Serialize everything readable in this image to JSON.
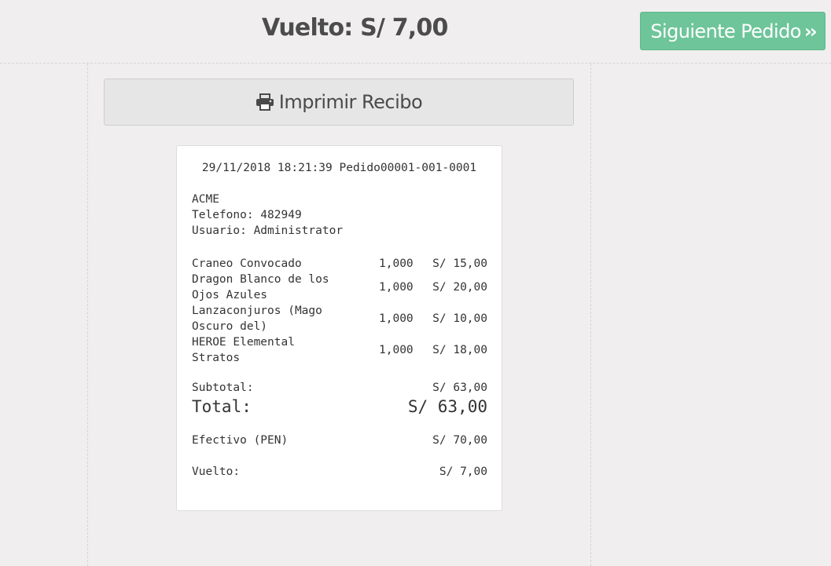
{
  "header": {
    "change_label": "Vuelto: S/ 7,00",
    "next_order_label": "Siguiente Pedido"
  },
  "print_button": {
    "label": "Imprimir Recibo"
  },
  "receipt": {
    "header_line": "29/11/2018 18:21:39 Pedido00001-001-0001",
    "company": "ACME",
    "phone": "Telefono: 482949",
    "user": "Usuario: Administrator",
    "items": [
      {
        "name_line1": "Craneo Convocado",
        "name_line2": "",
        "qty": "1,000",
        "price": "S/ 15,00"
      },
      {
        "name_line1": "Dragon Blanco de los",
        "name_line2": "Ojos Azules",
        "qty": "1,000",
        "price": "S/ 20,00"
      },
      {
        "name_line1": "Lanzaconjuros (Mago",
        "name_line2": "Oscuro del)",
        "qty": "1,000",
        "price": "S/ 10,00"
      },
      {
        "name_line1": "HEROE Elemental",
        "name_line2": "Stratos",
        "qty": "1,000",
        "price": "S/ 18,00"
      }
    ],
    "subtotal_label": "Subtotal:",
    "subtotal_value": "S/ 63,00",
    "total_label": "Total:",
    "total_value": "S/ 63,00",
    "payment_label": "Efectivo (PEN)",
    "payment_value": "S/ 70,00",
    "change_label": "Vuelto:",
    "change_value": "S/ 7,00"
  },
  "icons": {
    "print": "print-icon",
    "next": "double-chevron-right-icon"
  },
  "colors": {
    "next_button": "#6ec59a",
    "background": "#f0eeee"
  }
}
